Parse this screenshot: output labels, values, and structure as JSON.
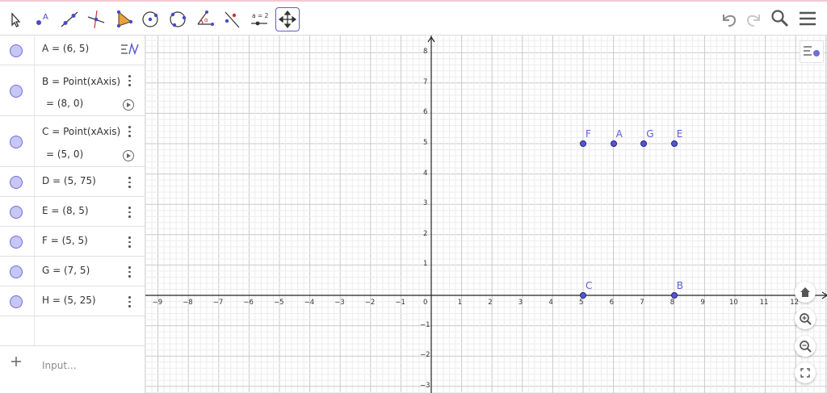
{
  "toolbar": {
    "tools": [
      "move-tool",
      "point-tool",
      "line-tool",
      "perpendicular-line-tool",
      "polygon-tool",
      "circle-center-point-tool",
      "circle-three-points-tool",
      "angle-tool",
      "reflect-about-line-tool",
      "slider-tool",
      "move-graphics-view-tool"
    ],
    "slider_label": "a = 2",
    "selected_tool": "move-graphics-view-tool",
    "right": [
      "undo-icon",
      "redo-icon",
      "search-icon",
      "menu-icon"
    ]
  },
  "algebra": {
    "rows": [
      {
        "line1": "A = (6, 5)"
      },
      {
        "line1": "B = Point(xAxis)",
        "line2": "= (8, 0)"
      },
      {
        "line1": "C = Point(xAxis)",
        "line2": "= (5, 0)"
      },
      {
        "line1": "D = (5, 75)"
      },
      {
        "line1": "E = (8, 5)"
      },
      {
        "line1": "F = (5, 5)"
      },
      {
        "line1": "G = (7, 5)"
      },
      {
        "line1": "H = (5, 25)"
      }
    ],
    "input_placeholder": "Input..."
  },
  "graphics": {
    "x_ticks": [
      "−9",
      "−8",
      "−7",
      "−6",
      "−5",
      "−4",
      "−3",
      "−2",
      "−1",
      "0",
      "1",
      "2",
      "3",
      "4",
      "5",
      "6",
      "7",
      "8",
      "9",
      "10",
      "11",
      "12"
    ],
    "y_ticks": [
      "8",
      "7",
      "6",
      "5",
      "4",
      "3",
      "2",
      "1",
      "−1",
      "−2",
      "−3"
    ],
    "points": [
      {
        "label": "F",
        "x": 5,
        "y": 5
      },
      {
        "label": "A",
        "x": 6,
        "y": 5
      },
      {
        "label": "G",
        "x": 7,
        "y": 5
      },
      {
        "label": "E",
        "x": 8,
        "y": 5
      },
      {
        "label": "C",
        "x": 5,
        "y": 0
      },
      {
        "label": "B",
        "x": 8,
        "y": 0
      }
    ],
    "point_color": "#5556d6",
    "zoom_buttons": [
      "home-icon",
      "zoom-in-icon",
      "zoom-out-icon",
      "fullscreen-icon"
    ]
  }
}
